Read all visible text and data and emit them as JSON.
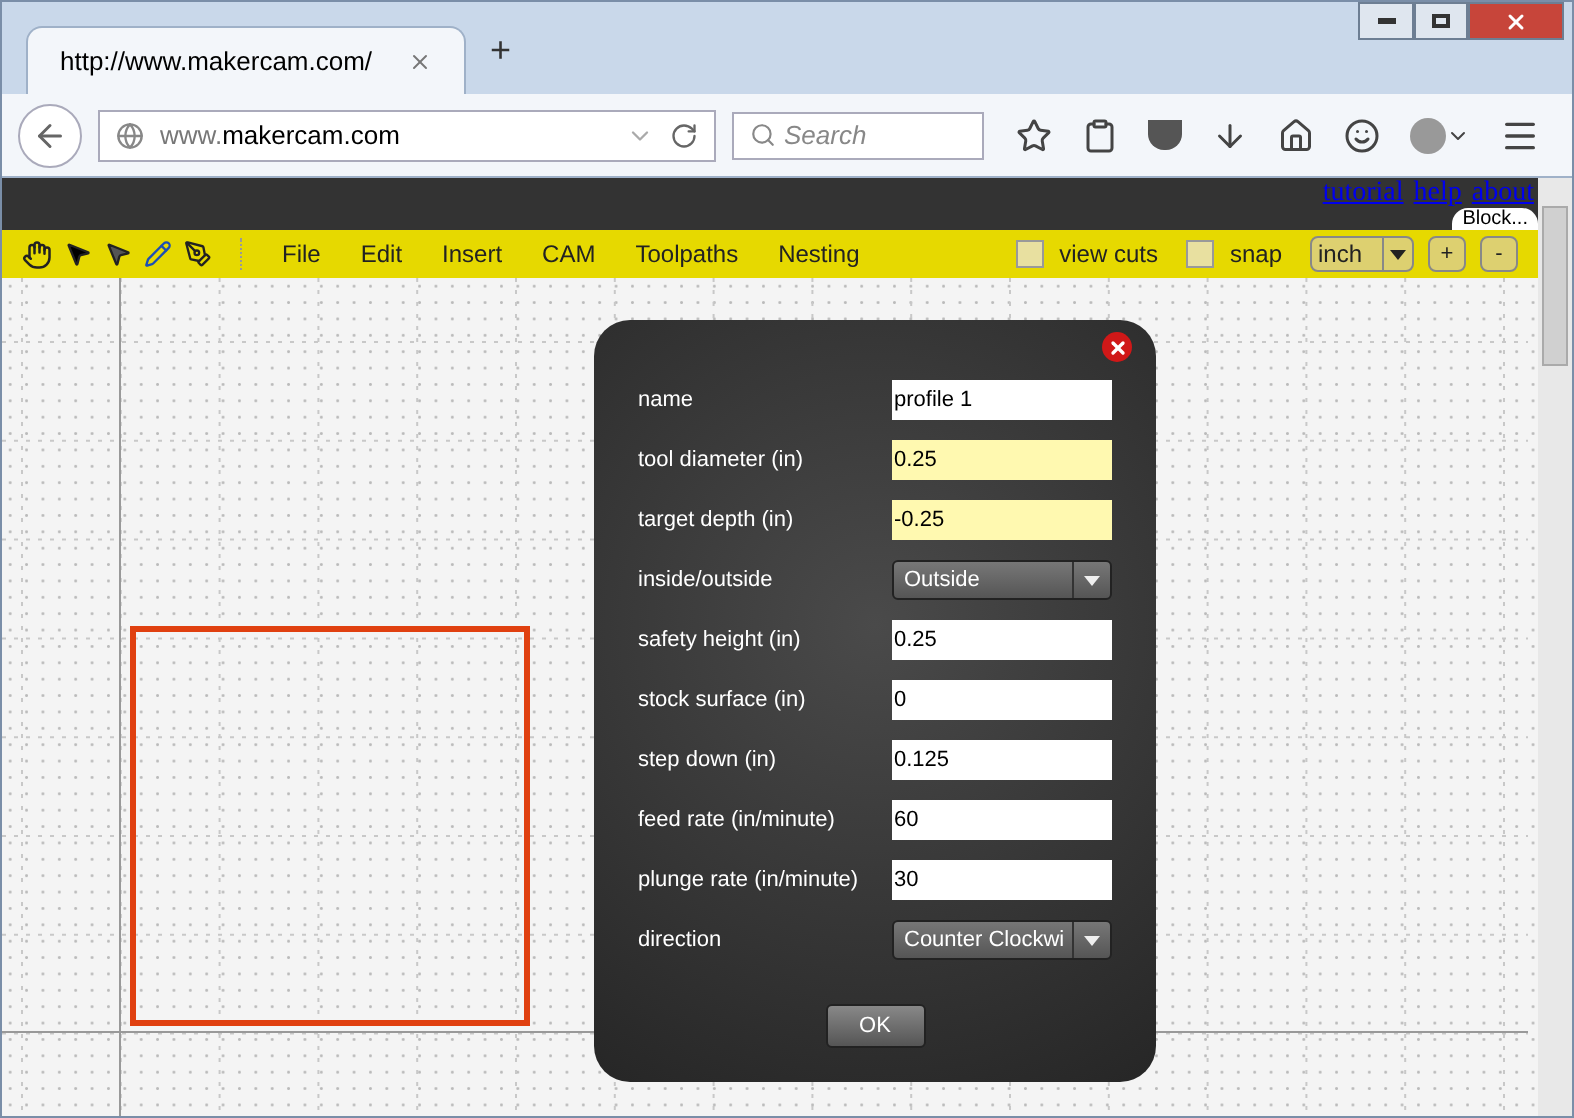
{
  "browser": {
    "tab_title": "http://www.makercam.com/",
    "new_tab": "+",
    "url_prefix": "www.",
    "url_domain": "makercam.com",
    "search_placeholder": "Search"
  },
  "header_links": [
    "tutorial",
    "help",
    "about"
  ],
  "popup_badge": "Block...",
  "menu": [
    "File",
    "Edit",
    "Insert",
    "CAM",
    "Toolpaths",
    "Nesting"
  ],
  "toggles": [
    {
      "label": "view cuts",
      "checked": false
    },
    {
      "label": "snap",
      "checked": false
    }
  ],
  "unit": "inch",
  "zoom_buttons": [
    "+",
    "-"
  ],
  "dialog": {
    "fields": [
      {
        "label": "name",
        "kind": "text",
        "value": "profile 1",
        "highlighted": false
      },
      {
        "label": "tool diameter (in)",
        "kind": "text",
        "value": "0.25",
        "highlighted": true
      },
      {
        "label": "target depth (in)",
        "kind": "text",
        "value": "-0.25",
        "highlighted": true
      },
      {
        "label": "inside/outside",
        "kind": "select",
        "value": "Outside"
      },
      {
        "label": "safety height (in)",
        "kind": "text",
        "value": "0.25",
        "highlighted": false
      },
      {
        "label": "stock surface (in)",
        "kind": "text",
        "value": "0",
        "highlighted": false
      },
      {
        "label": "step down (in)",
        "kind": "text",
        "value": "0.125",
        "highlighted": false
      },
      {
        "label": "feed rate (in/minute)",
        "kind": "text",
        "value": "60",
        "highlighted": false
      },
      {
        "label": "plunge rate (in/minute)",
        "kind": "text",
        "value": "30",
        "highlighted": false
      },
      {
        "label": "direction",
        "kind": "select",
        "value": "Counter Clockwi"
      }
    ],
    "ok": "OK"
  }
}
